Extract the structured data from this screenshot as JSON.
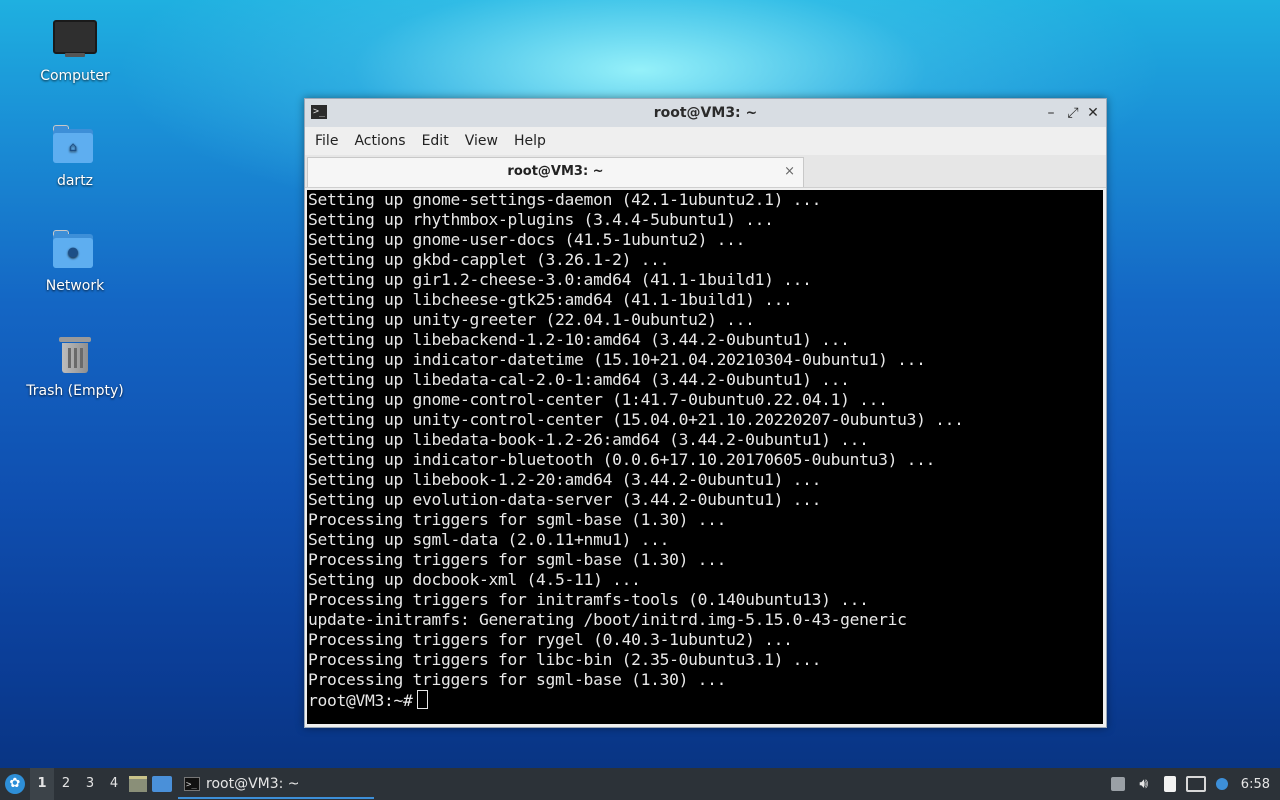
{
  "desktop": {
    "icons": [
      {
        "label": "Computer"
      },
      {
        "label": "dartz"
      },
      {
        "label": "Network"
      },
      {
        "label": "Trash (Empty)"
      }
    ]
  },
  "window": {
    "title": "root@VM3: ~",
    "controls": {
      "minimize": "–",
      "maximize": "⤢",
      "close": "✕"
    },
    "menu": [
      "File",
      "Actions",
      "Edit",
      "View",
      "Help"
    ],
    "tab": {
      "label": "root@VM3: ~",
      "close": "×"
    },
    "terminal": {
      "lines": [
        "Setting up gnome-settings-daemon (42.1-1ubuntu2.1) ...",
        "Setting up rhythmbox-plugins (3.4.4-5ubuntu1) ...",
        "Setting up gnome-user-docs (41.5-1ubuntu2) ...",
        "Setting up gkbd-capplet (3.26.1-2) ...",
        "Setting up gir1.2-cheese-3.0:amd64 (41.1-1build1) ...",
        "Setting up libcheese-gtk25:amd64 (41.1-1build1) ...",
        "Setting up unity-greeter (22.04.1-0ubuntu2) ...",
        "Setting up libebackend-1.2-10:amd64 (3.44.2-0ubuntu1) ...",
        "Setting up indicator-datetime (15.10+21.04.20210304-0ubuntu1) ...",
        "Setting up libedata-cal-2.0-1:amd64 (3.44.2-0ubuntu1) ...",
        "Setting up gnome-control-center (1:41.7-0ubuntu0.22.04.1) ...",
        "Setting up unity-control-center (15.04.0+21.10.20220207-0ubuntu3) ...",
        "Setting up libedata-book-1.2-26:amd64 (3.44.2-0ubuntu1) ...",
        "Setting up indicator-bluetooth (0.0.6+17.10.20170605-0ubuntu3) ...",
        "Setting up libebook-1.2-20:amd64 (3.44.2-0ubuntu1) ...",
        "Setting up evolution-data-server (3.44.2-0ubuntu1) ...",
        "Processing triggers for sgml-base (1.30) ...",
        "Setting up sgml-data (2.0.11+nmu1) ...",
        "Processing triggers for sgml-base (1.30) ...",
        "Setting up docbook-xml (4.5-11) ...",
        "Processing triggers for initramfs-tools (0.140ubuntu13) ...",
        "update-initramfs: Generating /boot/initrd.img-5.15.0-43-generic",
        "Processing triggers for rygel (0.40.3-1ubuntu2) ...",
        "Processing triggers for libc-bin (2.35-0ubuntu3.1) ...",
        "Processing triggers for sgml-base (1.30) ..."
      ],
      "prompt": "root@VM3:~#"
    }
  },
  "taskbar": {
    "workspaces": [
      "1",
      "2",
      "3",
      "4"
    ],
    "active_workspace": "1",
    "task_label": "root@VM3: ~",
    "clock": "6:58"
  },
  "colors": {
    "terminal_bg": "#000000",
    "terminal_fg": "#e8e8e8",
    "accent": "#3d8fd8",
    "panel": "#2c3238"
  }
}
